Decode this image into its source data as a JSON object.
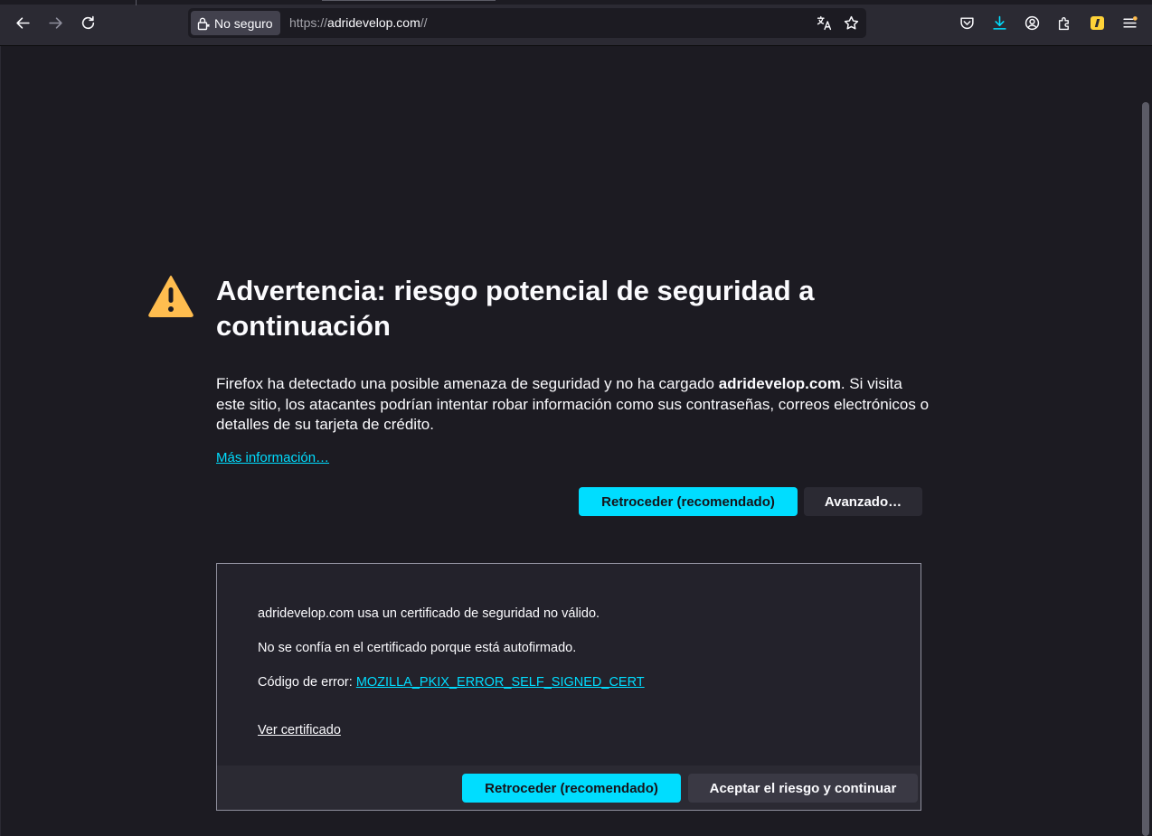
{
  "browser": {
    "security_label": "No seguro",
    "url_scheme": "https://",
    "url_host": "adridevelop.com",
    "url_path": "//",
    "icons": [
      "back-icon",
      "forward-icon",
      "reload-icon",
      "lock-warning-icon",
      "translate-icon",
      "bookmark-star-icon",
      "pocket-icon",
      "download-icon",
      "account-icon",
      "extensions-icon",
      "extension-app-icon",
      "menu-icon"
    ]
  },
  "warning": {
    "title": "Advertencia: riesgo potencial de seguridad a continuación",
    "desc_prefix": "Firefox ha detectado una posible amenaza de seguridad y no ha cargado ",
    "desc_host": "adridevelop.com",
    "desc_suffix": ". Si visita este sitio, los atacantes podrían intentar robar información como sus contraseñas, correos electrónicos o detalles de su tarjeta de crédito.",
    "learn_more": "Más información…",
    "go_back_button": "Retroceder (recomendado)",
    "advanced_button": "Avanzado…"
  },
  "advanced": {
    "line1": "adridevelop.com usa un certificado de seguridad no válido.",
    "line2": "No se confía en el certificado porque está autofirmado.",
    "error_label": "Código de error: ",
    "error_code": "MOZILLA_PKIX_ERROR_SELF_SIGNED_CERT",
    "view_cert": "Ver certificado",
    "go_back_button": "Retroceder (recomendado)",
    "accept_button": "Aceptar el riesgo y continuar"
  },
  "colors": {
    "background": "#1c1b22",
    "accent": "#00ddff",
    "warning_icon": "#ffbd4f",
    "toolbar": "#2b2a33"
  }
}
